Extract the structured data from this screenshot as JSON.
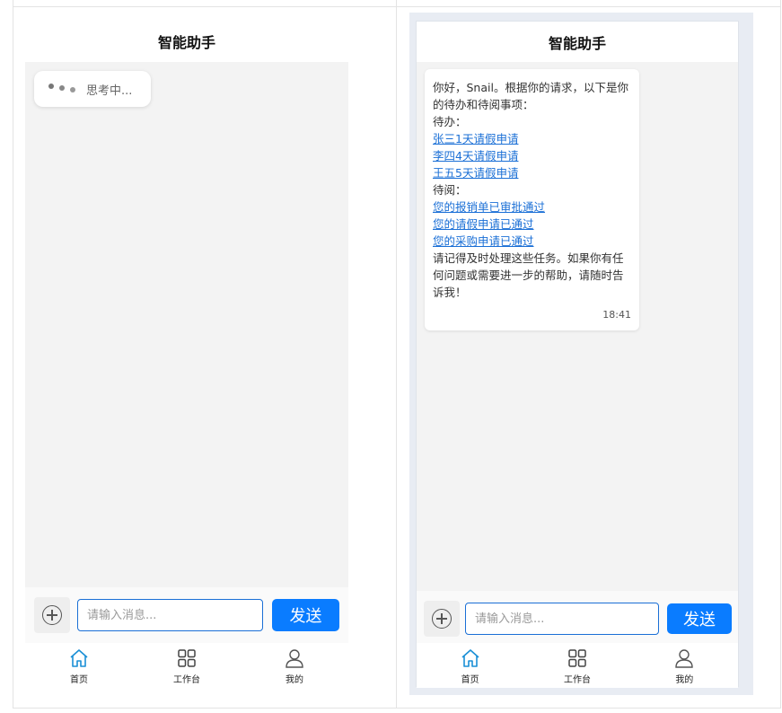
{
  "left": {
    "title": "智能助手",
    "thinking_text": "思考中...",
    "input_placeholder": "请输入消息...",
    "send_label": "发送",
    "tabs": [
      {
        "label": "首页",
        "icon": "home-icon",
        "active": true
      },
      {
        "label": "工作台",
        "icon": "grid-icon",
        "active": false
      },
      {
        "label": "我的",
        "icon": "user-icon",
        "active": false
      }
    ]
  },
  "right": {
    "title": "智能助手",
    "message": {
      "greeting": "你好，Snail。根据你的请求，以下是你的待办和待阅事项：",
      "todo_heading": "待办：",
      "todo_links": [
        "张三1天请假申请",
        "李四4天请假申请",
        "王五5天请假申请"
      ],
      "toread_heading": "待阅：",
      "toread_links": [
        "您的报销单已审批通过",
        "您的请假申请已通过",
        "您的采购申请已通过"
      ],
      "closing": "请记得及时处理这些任务。如果你有任何问题或需要进一步的帮助，请随时告诉我！",
      "time": "18:41"
    },
    "input_placeholder": "请输入消息...",
    "send_label": "发送",
    "tabs": [
      {
        "label": "首页",
        "icon": "home-icon",
        "active": true
      },
      {
        "label": "工作台",
        "icon": "grid-icon",
        "active": false
      },
      {
        "label": "我的",
        "icon": "user-icon",
        "active": false
      }
    ]
  },
  "colors": {
    "accent": "#0a7cff",
    "link": "#1a6fd6",
    "chat_bg": "#f3f3f3",
    "frame_bg": "#e8ecf3"
  }
}
